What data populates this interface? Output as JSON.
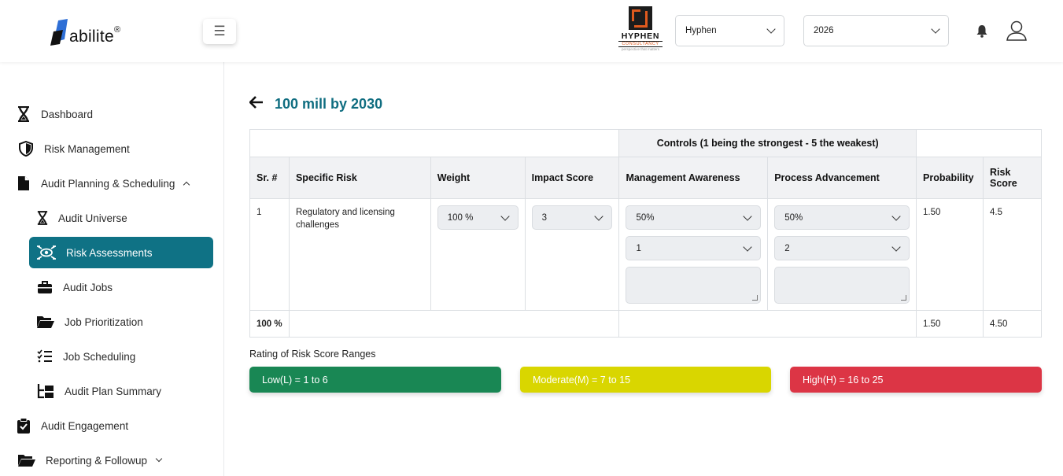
{
  "header": {
    "logo_text": "abilite",
    "logo_reg": "®",
    "menu_icon": "☰",
    "brand": {
      "name": "HYPHEN",
      "sub": "CONSULTANCY",
      "tag": "perspective that matters"
    },
    "company_select": "Hyphen",
    "year_select": "2026"
  },
  "sidebar": {
    "items": [
      {
        "label": "Dashboard"
      },
      {
        "label": "Risk Management"
      },
      {
        "label": "Audit Planning & Scheduling"
      },
      {
        "label": "Audit Universe"
      },
      {
        "label": "Risk Assessments"
      },
      {
        "label": "Audit Jobs"
      },
      {
        "label": "Job Prioritization"
      },
      {
        "label": "Job Scheduling"
      },
      {
        "label": "Audit Plan Summary"
      },
      {
        "label": "Audit Engagement"
      },
      {
        "label": "Reporting & Followup"
      }
    ]
  },
  "main": {
    "title": "100 mill by 2030",
    "table": {
      "controls_header": "Controls (1 being the strongest - 5 the weakest)",
      "columns": [
        "Sr. #",
        "Specific Risk",
        "Weight",
        "Impact Score",
        "Management Awareness",
        "Process Advancement",
        "Probability",
        "Risk Score"
      ],
      "row": {
        "sr": "1",
        "risk": "Regulatory and licensing challenges",
        "weight": "100 %",
        "impact": "3",
        "mgmt_pct": "50%",
        "mgmt_val": "1",
        "proc_pct": "50%",
        "proc_val": "2",
        "probability": "1.50",
        "risk_score": "4.5"
      },
      "footer": {
        "weight_total": "100 %",
        "probability": "1.50",
        "risk_score": "4.50"
      }
    },
    "rating": {
      "label": "Rating of Risk Score Ranges",
      "low": "Low(L) = 1 to 6",
      "moderate": "Moderate(M) = 7 to 15",
      "high": "High(H) = 16 to 25",
      "colors": {
        "low": "#198754",
        "moderate": "#d9d600",
        "high": "#dc3545"
      }
    }
  }
}
